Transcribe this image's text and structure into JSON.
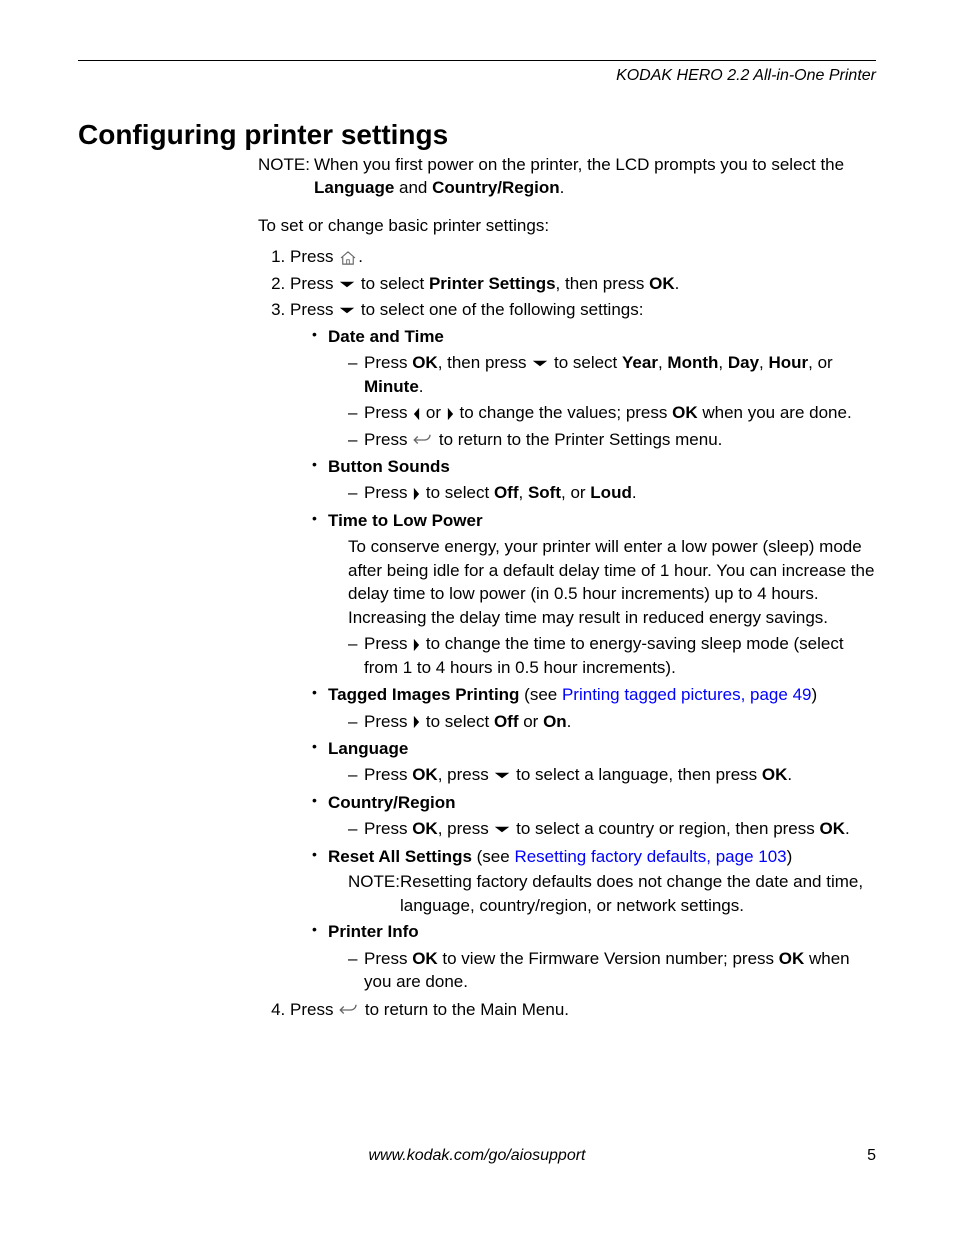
{
  "header": {
    "product": "KODAK HERO 2.2 All-in-One Printer"
  },
  "title": "Configuring printer settings",
  "note": {
    "label": "NOTE:",
    "text_1": "When you first power on the printer, the LCD prompts you to select the ",
    "text_b1": "Language",
    "text_2": " and ",
    "text_b2": "Country/Region",
    "text_3": "."
  },
  "intro": "To set or change basic printer settings:",
  "steps": {
    "s1": {
      "t1": "Press ",
      "t2": "."
    },
    "s2": {
      "t1": "Press ",
      "t2": " to select ",
      "b1": "Printer Settings",
      "t3": ", then press ",
      "b2": "OK",
      "t4": "."
    },
    "s3": {
      "t1": "Press ",
      "t2": " to select one of the following settings:"
    },
    "s4": {
      "t1": "Press ",
      "t2": " to return to the Main Menu."
    }
  },
  "opts": {
    "date": {
      "title": "Date and Time",
      "d1": {
        "t1": "Press ",
        "b1": "OK",
        "t2": ", then press ",
        "t3": " to select ",
        "b2": "Year",
        "t4": ", ",
        "b3": "Month",
        "t5": ", ",
        "b4": "Day",
        "t6": ", ",
        "b5": "Hour",
        "t7": ", or ",
        "b6": "Minute",
        "t8": "."
      },
      "d2": {
        "t1": "Press ",
        "t2": " or ",
        "t3": " to change the values; press ",
        "b1": "OK",
        "t4": " when you are done."
      },
      "d3": {
        "t1": "Press ",
        "t2": " to return to the Printer Settings menu."
      }
    },
    "buttons": {
      "title": "Button Sounds",
      "d1": {
        "t1": "Press ",
        "t2": " to select ",
        "b1": "Off",
        "t3": ", ",
        "b2": "Soft",
        "t4": ", or ",
        "b3": "Loud",
        "t5": "."
      }
    },
    "lowpower": {
      "title": "Time to Low Power",
      "para": "To conserve energy, your printer will enter a low power (sleep) mode after being idle for a default delay time of 1 hour. You can increase the delay time to low power (in 0.5 hour increments) up to 4 hours. Increasing the delay time may result in reduced energy savings.",
      "d1": {
        "t1": "Press ",
        "t2": " to change the time to energy-saving sleep mode (select from 1 to 4 hours in 0.5 hour increments)."
      }
    },
    "tagged": {
      "title": "Tagged Images Printing",
      "see_open": " (see ",
      "see_link": "Printing tagged pictures, page 49",
      "see_close": ")",
      "d1": {
        "t1": "Press ",
        "t2": " to select ",
        "b1": "Off",
        "t3": " or ",
        "b2": "On",
        "t4": "."
      }
    },
    "language": {
      "title": "Language",
      "d1": {
        "t1": "Press ",
        "b1": "OK",
        "t2": ", press ",
        "t3": " to select a language, then press ",
        "b2": "OK",
        "t4": "."
      }
    },
    "country": {
      "title": "Country/Region",
      "d1": {
        "t1": "Press ",
        "b1": "OK",
        "t2": ", press ",
        "t3": " to select a country or region, then press ",
        "b2": "OK",
        "t4": "."
      }
    },
    "reset": {
      "title": "Reset All Settings",
      "see_open": " (see ",
      "see_link": "Resetting factory defaults, page 103",
      "see_close": ")",
      "note_label": "NOTE:",
      "note_text": "Resetting factory defaults does not change the date and time, language, country/region, or network settings."
    },
    "info": {
      "title": "Printer Info",
      "d1": {
        "t1": "Press ",
        "b1": "OK",
        "t2": " to view the Firmware Version number; press ",
        "b2": "OK",
        "t3": " when you are done."
      }
    }
  },
  "footer": {
    "url": "www.kodak.com/go/aiosupport",
    "page": "5"
  }
}
